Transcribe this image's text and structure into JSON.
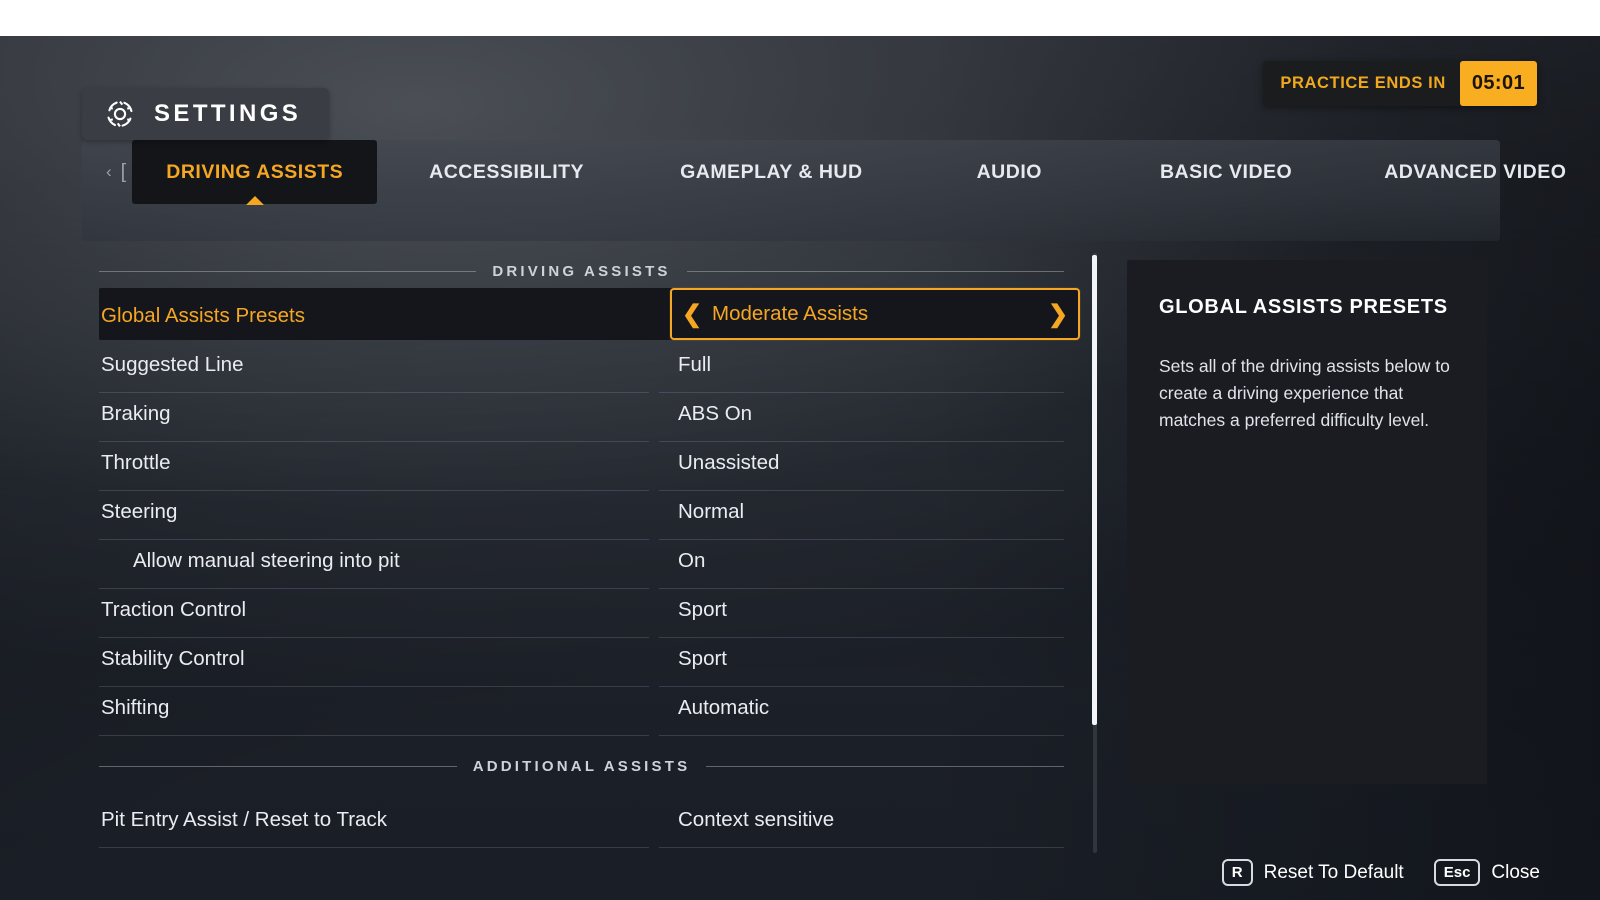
{
  "header": {
    "title": "SETTINGS",
    "gear_icon": "gear-icon"
  },
  "timer": {
    "label": "PRACTICE ENDS IN",
    "value": "05:01",
    "accent_color": "#f9ad21"
  },
  "tabs": {
    "prev_arrow": "‹",
    "prev_bracket": "[",
    "next_bracket": "]",
    "next_arrow": "›",
    "items": [
      {
        "label": "DRIVING ASSISTS",
        "active": true
      },
      {
        "label": "ACCESSIBILITY",
        "active": false
      },
      {
        "label": "GAMEPLAY & HUD",
        "active": false
      },
      {
        "label": "AUDIO",
        "active": false
      },
      {
        "label": "BASIC VIDEO",
        "active": false
      },
      {
        "label": "ADVANCED VIDEO",
        "active": false
      }
    ]
  },
  "sections": [
    {
      "title": "DRIVING ASSISTS",
      "rows": [
        {
          "label": "Global Assists Presets",
          "value": "Moderate Assists",
          "selected": true,
          "indent": false
        },
        {
          "label": "Suggested Line",
          "value": "Full",
          "selected": false,
          "indent": false
        },
        {
          "label": "Braking",
          "value": "ABS On",
          "selected": false,
          "indent": false
        },
        {
          "label": "Throttle",
          "value": "Unassisted",
          "selected": false,
          "indent": false
        },
        {
          "label": "Steering",
          "value": "Normal",
          "selected": false,
          "indent": false
        },
        {
          "label": "Allow manual steering into pit",
          "value": "On",
          "selected": false,
          "indent": true
        },
        {
          "label": "Traction Control",
          "value": "Sport",
          "selected": false,
          "indent": false
        },
        {
          "label": "Stability Control",
          "value": "Sport",
          "selected": false,
          "indent": false
        },
        {
          "label": "Shifting",
          "value": "Automatic",
          "selected": false,
          "indent": false
        }
      ]
    },
    {
      "title": "ADDITIONAL ASSISTS",
      "rows": [
        {
          "label": "Pit Entry Assist / Reset to Track",
          "value": "Context sensitive",
          "selected": false,
          "indent": false
        }
      ]
    }
  ],
  "info_panel": {
    "heading": "GLOBAL ASSISTS PRESETS",
    "body": "Sets all of the driving assists below to create a driving experience that matches a preferred difficulty level."
  },
  "footer": {
    "hints": [
      {
        "key": "R",
        "label": "Reset To Default"
      },
      {
        "key": "Esc",
        "label": "Close"
      }
    ]
  },
  "theme": {
    "accent": "#f5a623",
    "panel_bg": "#1a1c22",
    "selected_bg": "#15161b"
  }
}
